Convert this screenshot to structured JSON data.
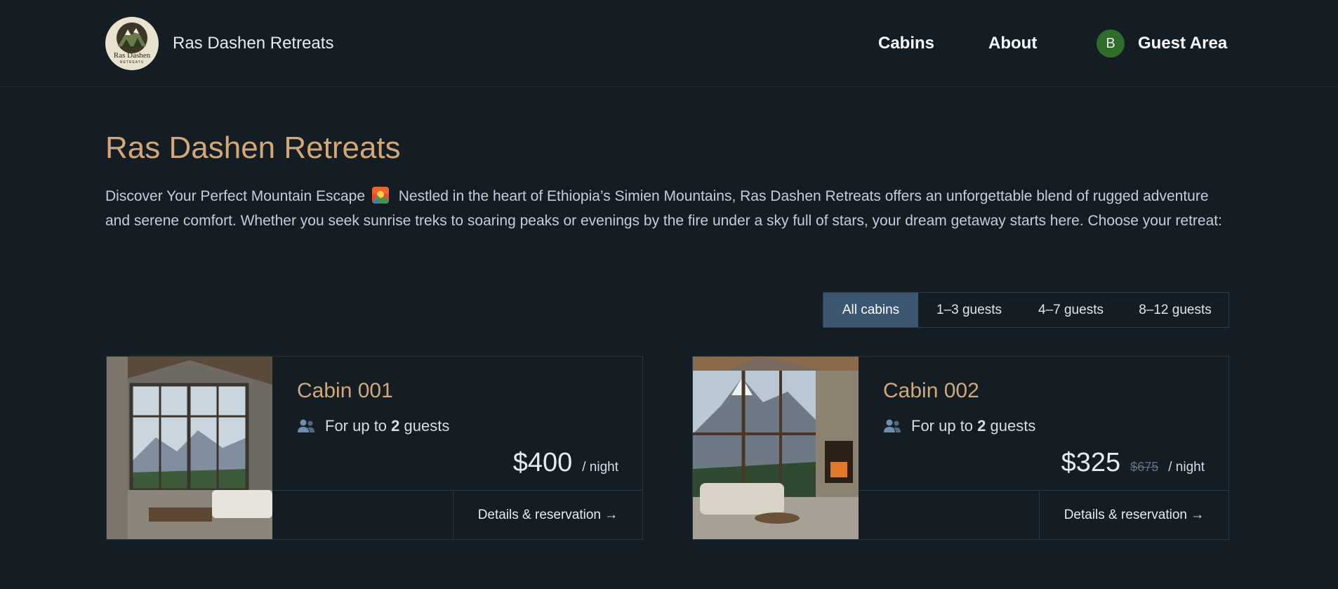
{
  "header": {
    "brand": "Ras Dashen Retreats",
    "logo_text_top": "Ras Dashen",
    "logo_text_bottom": "RETREATS",
    "nav": {
      "cabins": "Cabins",
      "about": "About",
      "guest_area": "Guest Area",
      "avatar_initial": "B"
    }
  },
  "main": {
    "title": "Ras Dashen Retreats",
    "intro_part1": "Discover Your Perfect Mountain Escape",
    "intro_part2": "Nestled in the heart of Ethiopia’s Simien Mountains, Ras Dashen Retreats offers an unforgettable blend of rugged adventure and serene comfort. Whether you seek sunrise treks to soaring peaks or evenings by the fire under a sky full of stars, your dream getaway starts here. Choose your retreat:",
    "filters": [
      "All cabins",
      "1–3 guests",
      "4–7 guests",
      "8–12 guests"
    ],
    "active_filter": "All cabins"
  },
  "cabins": [
    {
      "name": "Cabin 001",
      "guests_prefix": "For up to ",
      "guests_count": "2",
      "guests_suffix": " guests",
      "price": "$400",
      "old_price": "",
      "unit": "/ night",
      "cta": "Details & reservation →"
    },
    {
      "name": "Cabin 002",
      "guests_prefix": "For up to ",
      "guests_count": "2",
      "guests_suffix": " guests",
      "price": "$325",
      "old_price": "$675",
      "unit": "/ night",
      "cta": "Details & reservation →"
    }
  ],
  "colors": {
    "background": "#141c24",
    "accent": "#d4a776",
    "active_filter": "#3c5570",
    "avatar": "#2f6b2b"
  }
}
